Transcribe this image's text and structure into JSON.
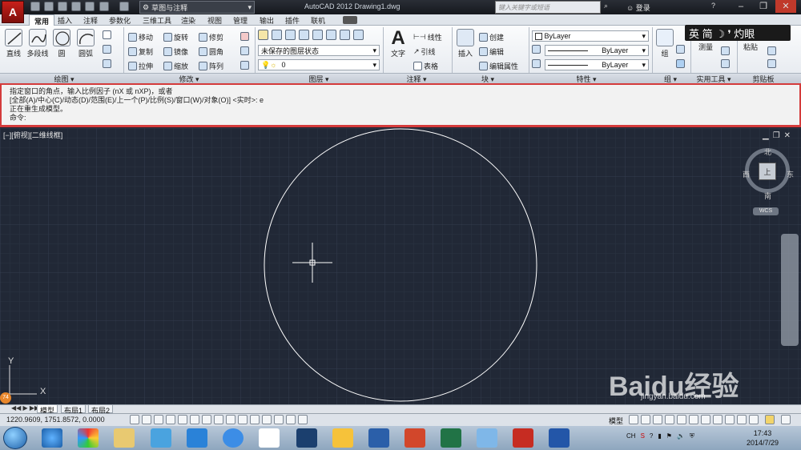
{
  "window": {
    "workspace": "草图与注释",
    "title": "AutoCAD 2012    Drawing1.dwg",
    "search_placeholder": "键入关键字或短语",
    "login": "登录",
    "help": "?"
  },
  "tabs": [
    "常用",
    "插入",
    "注释",
    "参数化",
    "三维工具",
    "渲染",
    "视图",
    "管理",
    "输出",
    "插件",
    "联机"
  ],
  "ribbon": {
    "draw": {
      "line": "直线",
      "polyline": "多段线",
      "circle": "圆",
      "arc": "圆弧",
      "label": "绘图"
    },
    "modify": {
      "move": "移动",
      "rotate": "旋转",
      "trim": "修剪",
      "copy": "复制",
      "mirror": "镜像",
      "fillet": "圆角",
      "stretch": "拉伸",
      "scale": "缩放",
      "array": "阵列",
      "label": "修改"
    },
    "layers": {
      "state": "未保存的图层状态",
      "current": "0",
      "label": "图层"
    },
    "annotation": {
      "text": "文字",
      "linear": "线性",
      "leader": "引线",
      "table": "表格",
      "label": "注释"
    },
    "block": {
      "insert": "插入",
      "create": "创建",
      "edit": "编辑",
      "edit_attr": "编辑属性",
      "label": "块"
    },
    "properties": {
      "color": "ByLayer",
      "linetype": "ByLayer",
      "lineweight": "ByLayer",
      "label": "特性"
    },
    "group": {
      "group": "组",
      "label": "组"
    },
    "utilities": {
      "measure": "测量",
      "label": "实用工具"
    },
    "clipboard": {
      "paste": "粘贴",
      "label": "剪贴板"
    }
  },
  "ime": {
    "text": "英 简 ☽ ❜ 灼眼"
  },
  "command": {
    "line1": "指定窗口的角点，输入比例因子 (nX 或 nXP)，或者",
    "line2": "[全部(A)/中心(C)/动态(D)/范围(E)/上一个(P)/比例(S)/窗口(W)/对象(O)] <实时>: e",
    "line3": "正在重生成模型。",
    "prompt": "命令:"
  },
  "viewport": {
    "label": "[−][俯视][二维线框]",
    "viewcube": {
      "n": "北",
      "s": "南",
      "e": "东",
      "w": "西",
      "face": "上",
      "wcs": "WCS"
    },
    "ucs": {
      "x": "X",
      "y": "Y"
    },
    "watermark": "Baidu经验",
    "watermark_url": "jingyan.baidu.com",
    "badge": "74"
  },
  "layout_tabs": [
    "模型",
    "布局1",
    "布局2"
  ],
  "status": {
    "coords": "1220.9609,  1751.8572,  0.0000",
    "model": "模型"
  },
  "taskbar": {
    "time": "17:43",
    "date": "2014/7/29",
    "tray": "CH"
  },
  "colors": {
    "accent": "#d43b3b",
    "viewport": "#212836",
    "circle": "#ffffff"
  }
}
